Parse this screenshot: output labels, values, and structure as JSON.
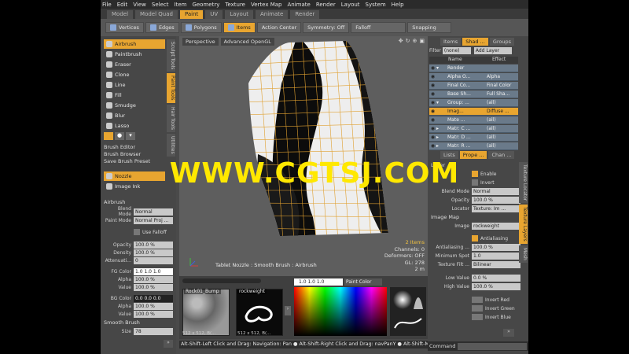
{
  "menu": [
    "File",
    "Edit",
    "View",
    "Select",
    "Item",
    "Geometry",
    "Texture",
    "Vertex Map",
    "Animate",
    "Render",
    "Layout",
    "System",
    "Help"
  ],
  "layout_tabs": [
    "Model",
    "Model Quad",
    "Paint",
    "UV",
    "Layout",
    "Animate",
    "Render"
  ],
  "active_layout_tab": "Paint",
  "toolbar": {
    "vertices": "Vertices",
    "edges": "Edges",
    "polygons": "Polygons",
    "items": "Items",
    "action_center": "Action Center",
    "symmetry": "Symmetry: Off",
    "falloff": "Falloff",
    "snapping": "Snapping"
  },
  "left_tools": {
    "airbrush": "Airbrush",
    "paintbrush": "Paintbrush",
    "eraser": "Eraser",
    "clone": "Clone",
    "line": "Line",
    "fill": "Fill",
    "smudge": "Smudge",
    "blur": "Blur",
    "lasso": "Lasso",
    "brush_editor": "Brush Editor",
    "brush_browser": "Brush Browser",
    "save_preset": "Save Brush Preset",
    "nozzle": "Nozzle",
    "image_ink": "Image Ink",
    "vtabs": [
      "Sculpt Tools",
      "Paint Tools",
      "Hair Tools",
      "Utilities"
    ]
  },
  "props": {
    "section": "Airbrush",
    "blend_mode_label": "Blend Mode",
    "blend_mode": "Normal",
    "paint_mode_label": "Paint Mode",
    "paint_mode": "Normal Proj ...",
    "use_falloff": "Use Falloff",
    "opacity_label": "Opacity",
    "opacity": "100.0 %",
    "density_label": "Density",
    "density": "100.0 %",
    "atten_label": "Attenuati...",
    "atten": "0",
    "fg_label": "FG Color",
    "fg": "1.0  1.0  1.0",
    "alpha_label": "Alpha",
    "fg_alpha": "100.0 %",
    "value_label": "Value",
    "fg_value": "100.0 %",
    "bg_label": "BG Color",
    "bg": "0.0  0.0  0.0",
    "bg_alpha": "100.0 %",
    "bg_value": "100.0 %",
    "smooth": "Smooth Brush",
    "size_label": "Size",
    "size": "78"
  },
  "viewport": {
    "tab1": "Perspective",
    "tab2": "Advanced OpenGL",
    "items": "2 Items",
    "channels": "Channels: 0",
    "deformers": "Deformers: OFF",
    "gl": "GL: 278",
    "scale": "2 m",
    "footer": "Tablet Nozzle : Smooth Brush : Airbrush"
  },
  "bottom": {
    "thumb1": "Rock01_Bump",
    "thumb2": "rockweight",
    "size1": "512 x 512, B(...",
    "size2": "512 x 512, B(...",
    "color": "1.0   1.0   1.0",
    "paint_color": "Paint Color"
  },
  "status": "Alt-Shift-Left Click and Drag: Navigation: Pan ● Alt-Shift-Right Click and Drag: navPanY ● Alt-Shift-Middle ...",
  "command_label": "Command",
  "right": {
    "top_tabs": [
      "Items",
      "Shad ...",
      "Groups"
    ],
    "filter_label": "Filter",
    "filter": "(none)",
    "add_layer": "Add Layer",
    "col_name": "Name",
    "col_effect": "Effect",
    "rows": [
      {
        "n": "Render",
        "e": ""
      },
      {
        "n": "Alpha O...",
        "e": "Alpha"
      },
      {
        "n": "Final Co...",
        "e": "Final Color"
      },
      {
        "n": "Base Sh...",
        "e": "Full Sha..."
      },
      {
        "n": "Group: ...",
        "e": "(all)"
      },
      {
        "n": "Imag...",
        "e": "Diffuse ..."
      },
      {
        "n": "Mate ...",
        "e": "(all)"
      },
      {
        "n": "Matr: C ...",
        "e": "(all)"
      },
      {
        "n": "Matr: D ...",
        "e": "(all)"
      },
      {
        "n": "Matr: R ...",
        "e": "(all)"
      }
    ],
    "mid_tabs": [
      "Lists",
      "Prope ...",
      "Chan ..."
    ],
    "layer": "Layer",
    "enable": "Enable",
    "invert": "Invert",
    "blend_label": "Blend Mode",
    "blend": "Normal",
    "opacity_label": "Opacity",
    "opacity": "100.0 %",
    "locator_label": "Locator",
    "locator": "Texture: Im ...",
    "image_map": "Image Map",
    "image_label": "Image",
    "image": "rockweight",
    "antialiasing": "Antialiasing",
    "aa_label": "Antialiasing ...",
    "aa": "100.0 %",
    "minspot_label": "Minimum Spot",
    "minspot": "1.0",
    "texfilt_label": "Texture Filt ...",
    "texfilt": "Bilinear",
    "low_label": "Low Value",
    "low": "0.0 %",
    "high_label": "High Value",
    "high": "100.0 %",
    "inv_red": "Invert Red",
    "inv_green": "Invert Green",
    "inv_blue": "Invert Blue",
    "side_tabs": [
      "Texture Locator",
      "Texture Layers",
      "Mesh"
    ]
  },
  "watermark": "WWW.CGTSJ.COM"
}
